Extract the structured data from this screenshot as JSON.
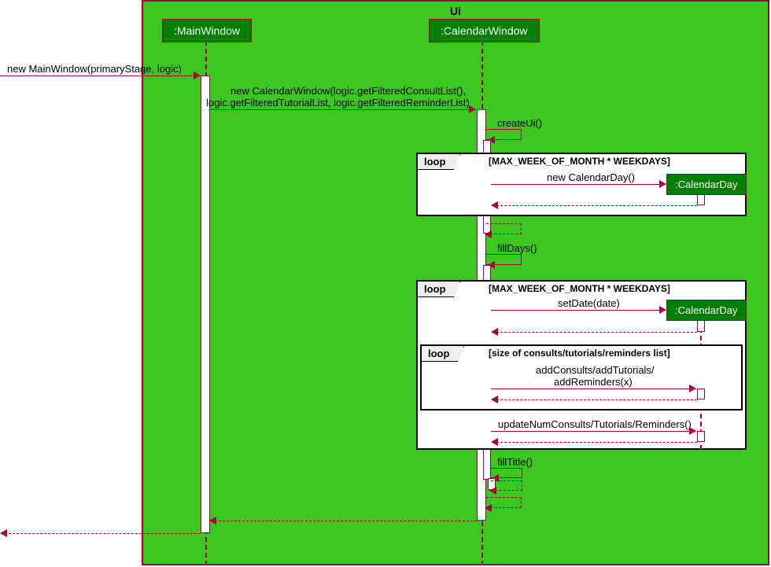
{
  "frame_title": "Ui",
  "participants": {
    "main_window": ":MainWindow",
    "calendar_window": ":CalendarWindow",
    "calendar_day": ":CalendarDay"
  },
  "messages": {
    "new_main": "new MainWindow(primaryStage, logic)",
    "new_calendar_l1": "new CalendarWindow(logic.getFilteredConsultList(),",
    "new_calendar_l2": "logic.getFilteredTutorialList, logic.getFilteredReminderList)",
    "create_ui": "createUi()",
    "new_day": "new CalendarDay()",
    "fill_days": "fillDays()",
    "set_date": "setDate(date)",
    "add_items_l1": "addConsults/addTutorials/",
    "add_items_l2": "addReminders(x)",
    "update_nums": "updateNumConsults/Tutorials/Reminders()",
    "fill_title": "fillTitle()"
  },
  "loops": {
    "loop_label": "loop",
    "cond1": "[MAX_WEEK_OF_MONTH * WEEKDAYS]",
    "cond2": "[MAX_WEEK_OF_MONTH * WEEKDAYS]",
    "cond3": "[size of consults/tutorials/reminders list]"
  }
}
